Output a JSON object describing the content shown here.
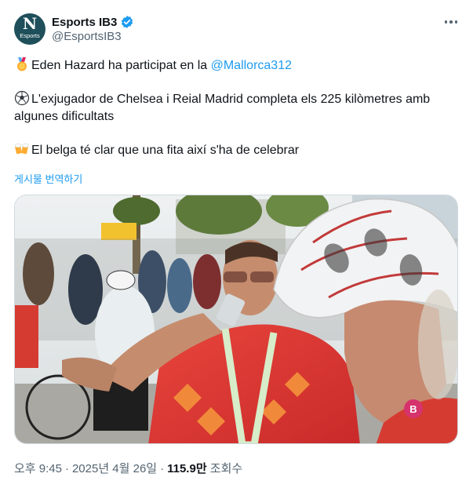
{
  "author": {
    "display_name": "Esports IB3",
    "handle": "@EsportsIB3",
    "avatar_letter": "N",
    "avatar_caption": "Esports",
    "verified_icon": "verified-badge-icon",
    "verified_color": "#1d9bf0",
    "avatar_color": "#1e4f5a"
  },
  "more_icon": "more-options-icon",
  "tweet": {
    "line1_emoji": "medal",
    "line1_text": "Eden Hazard ha participat en la ",
    "mention": "@Mallorca312",
    "line2_emoji": "soccer-ball",
    "line2_text": "L'exjugador de Chelsea i Reial Madrid completa els 225 kilòmetres amb algunes dificultats",
    "line3_emoji": "beer-mugs",
    "line3_text": "El belga té clar que una fita així s'ha de celebrar"
  },
  "translate_label": "게시물 번역하기",
  "media": {
    "kind": "video-still",
    "watermark": "IB3"
  },
  "meta": {
    "time": "오후 9:45",
    "date": "2025년 4월 26일",
    "separator": "·",
    "views_count": "115.9만",
    "views_label": "조회수"
  },
  "colors": {
    "link": "#1d9bf0",
    "secondary_text": "#536471",
    "primary_text": "#0f1419"
  }
}
